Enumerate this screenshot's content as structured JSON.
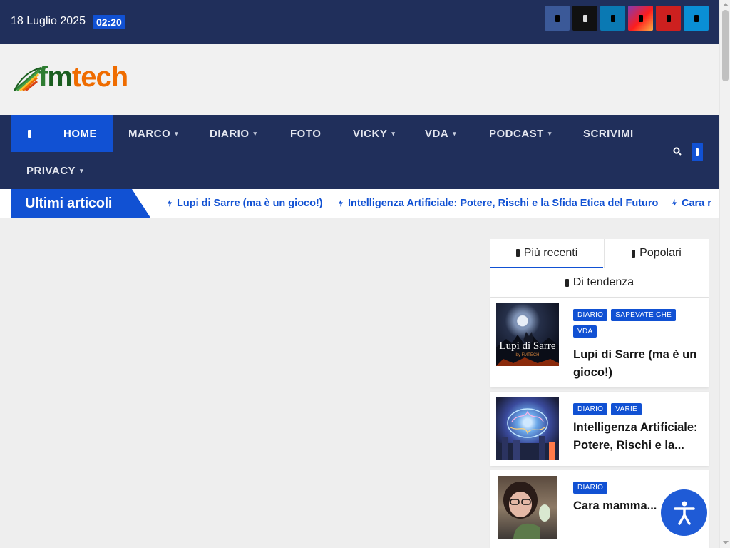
{
  "topbar": {
    "date": "18 Luglio 2025",
    "time": "02:20",
    "socials": [
      "facebook-icon",
      "x-twitter-icon",
      "linkedin-icon",
      "instagram-icon",
      "youtube-icon",
      "telegram-icon"
    ]
  },
  "logo": {
    "f": "f",
    "m": "m",
    "tech": "tech"
  },
  "nav": {
    "items": [
      {
        "label": "HOME",
        "caret": ""
      },
      {
        "label": "MARCO",
        "caret": "▾"
      },
      {
        "label": "DIARIO",
        "caret": "▾"
      },
      {
        "label": "FOTO",
        "caret": ""
      },
      {
        "label": "VICKY",
        "caret": "▾"
      },
      {
        "label": "VDA",
        "caret": "▾"
      },
      {
        "label": "PODCAST",
        "caret": "▾"
      },
      {
        "label": "SCRIVIMI",
        "caret": ""
      },
      {
        "label": "PRIVACY",
        "caret": "▾"
      }
    ]
  },
  "ticker": {
    "label": "Ultimi articoli",
    "items": [
      "Lupi di Sarre (ma è un gioco!)",
      "Intelligenza Artificiale: Potere, Rischi e la Sfida Etica del Futuro",
      "Cara r"
    ]
  },
  "sidebar": {
    "tabs": {
      "recenti": "Più recenti",
      "popolari": "Popolari",
      "tendenza": "Di tendenza"
    },
    "posts": [
      {
        "categories": [
          "DIARIO",
          "SAPEVATE CHE",
          "VDA"
        ],
        "title": "Lupi di Sarre (ma è un gioco!)",
        "thumb_text": "Lupi di Sarre",
        "thumb_sub": "by FMTECH"
      },
      {
        "categories": [
          "DIARIO",
          "VARIE"
        ],
        "title": "Intelligenza Artificiale: Potere, Rischi e la..."
      },
      {
        "categories": [
          "DIARIO"
        ],
        "title": "Cara mamma..."
      }
    ]
  },
  "colors": {
    "navy": "#202f5b",
    "accent": "#1151d3"
  }
}
